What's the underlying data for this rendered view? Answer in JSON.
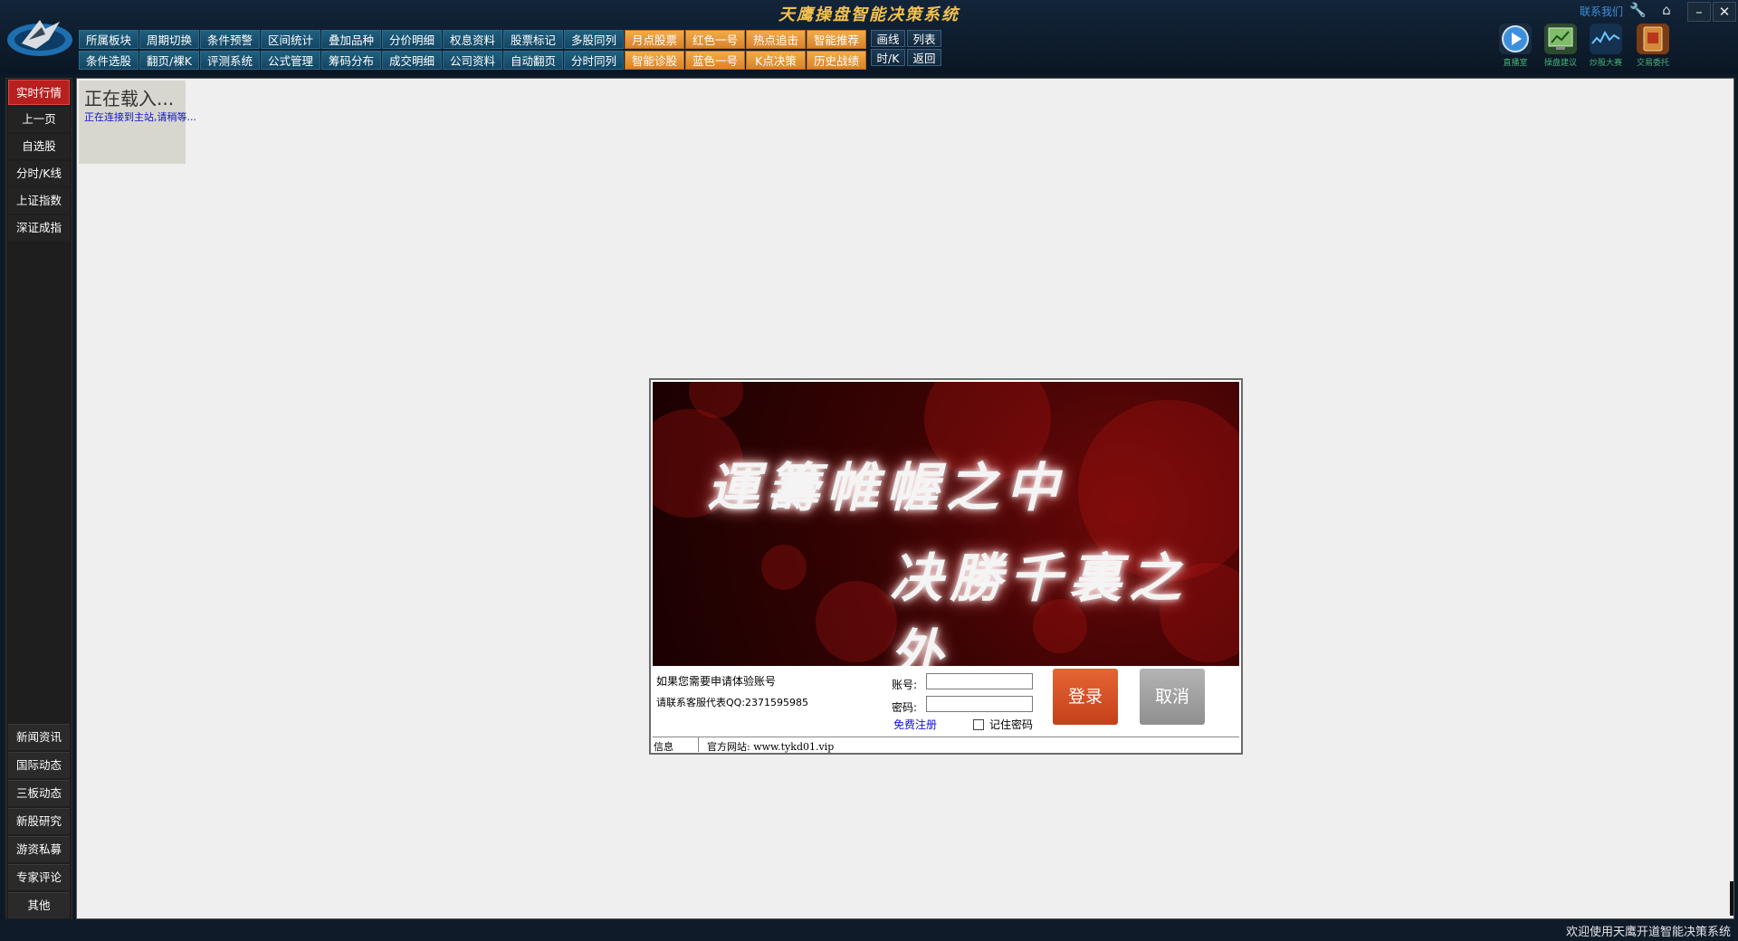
{
  "app": {
    "title": "天鹰操盘智能决策系统",
    "contact": "联系我们"
  },
  "toolbar": {
    "row1": [
      {
        "label": "所属板块",
        "style": "blue"
      },
      {
        "label": "周期切换",
        "style": "blue"
      },
      {
        "label": "条件预警",
        "style": "blue"
      },
      {
        "label": "区间统计",
        "style": "blue"
      },
      {
        "label": "叠加品种",
        "style": "blue"
      },
      {
        "label": "分价明细",
        "style": "blue"
      },
      {
        "label": "权息资料",
        "style": "blue"
      },
      {
        "label": "股票标记",
        "style": "blue"
      },
      {
        "label": "多股同列",
        "style": "blue"
      },
      {
        "label": "月点股票",
        "style": "orange"
      },
      {
        "label": "红色一号",
        "style": "orange"
      },
      {
        "label": "热点追击",
        "style": "orange"
      },
      {
        "label": "智能推荐",
        "style": "orange"
      }
    ],
    "row2": [
      {
        "label": "条件选股",
        "style": "blue"
      },
      {
        "label": "翻页/裸K",
        "style": "blue"
      },
      {
        "label": "评测系统",
        "style": "blue"
      },
      {
        "label": "公式管理",
        "style": "blue"
      },
      {
        "label": "筹码分布",
        "style": "blue"
      },
      {
        "label": "成交明细",
        "style": "blue"
      },
      {
        "label": "公司资料",
        "style": "blue"
      },
      {
        "label": "自动翻页",
        "style": "blue"
      },
      {
        "label": "分时同列",
        "style": "blue"
      },
      {
        "label": "智能诊股",
        "style": "orange"
      },
      {
        "label": "蓝色一号",
        "style": "orange"
      },
      {
        "label": "K点决策",
        "style": "orange"
      },
      {
        "label": "历史战绩",
        "style": "orange"
      }
    ],
    "small": [
      "画线",
      "列表",
      "时/K",
      "返回"
    ]
  },
  "quick_tools": [
    {
      "label": "直播室",
      "icon": "play-icon"
    },
    {
      "label": "操盘建议",
      "icon": "monitor-chart-icon"
    },
    {
      "label": "炒股大赛",
      "icon": "wave-chart-icon"
    },
    {
      "label": "交易委托",
      "icon": "entrust-book-icon"
    }
  ],
  "sidebar": {
    "top": [
      "实时行情",
      "上一页",
      "自选股",
      "分时/K线",
      "上证指数",
      "深证成指"
    ],
    "bottom": [
      "新闻资讯",
      "国际动态",
      "三板动态",
      "新股研究",
      "游资私募",
      "专家评论",
      "其他"
    ]
  },
  "loading": {
    "title": "正在载入...",
    "subtitle": "正在连接到主站,请稍等..."
  },
  "login": {
    "slogan_line1": "運籌帷幄之中",
    "slogan_line2": "决勝千裏之外",
    "info_line1": "如果您需要申请体验账号",
    "info_line2": "请联系客服代表QQ:2371595985",
    "account_label": "账号:",
    "password_label": "密码:",
    "account_value": "",
    "password_value": "",
    "register_link": "免费注册",
    "remember_label": "记住密码",
    "login_button": "登录",
    "cancel_button": "取消",
    "status_label": "信息",
    "status_site": "官方网站: www.tykd01.vip"
  },
  "footer": {
    "message": "欢迎使用天鹰开道智能决策系统"
  },
  "colors": {
    "accent_orange": "#e8953b",
    "toolbar_blue": "#1a5677",
    "active_red": "#b81f1f",
    "title_gold": "#f2c14e"
  }
}
